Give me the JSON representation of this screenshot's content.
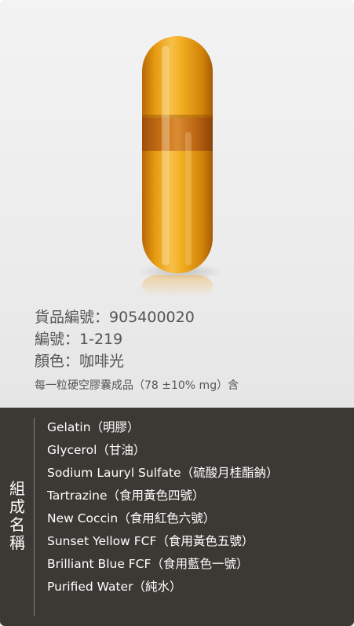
{
  "product": {
    "code_label": "貨品編號：",
    "code_value": "905400020",
    "number_label": "編號：",
    "number_value": "1-219",
    "color_label": "顏色：",
    "color_value": "咖啡光",
    "note": "每一粒硬空膠囊成品（78 ±10% mg）含"
  },
  "composition": {
    "label_chars": [
      "組",
      "成",
      "名",
      "稱"
    ],
    "items": [
      "Gelatin（明膠）",
      "Glycerol（甘油）",
      "Sodium Lauryl Sulfate（硫酸月桂酯鈉）",
      "Tartrazine（食用黃色四號）",
      "New Coccin（食用紅色六號）",
      "Sunset Yellow FCF（食用黃色五號）",
      "Brilliant Blue FCF（食用藍色一號）",
      "Purified Water（純水）"
    ]
  },
  "colors": {
    "capsule_body": "#f2a20c",
    "capsule_band": "#c96a12",
    "panel_dark": "#3c3834",
    "panel_light": "#ececec"
  }
}
